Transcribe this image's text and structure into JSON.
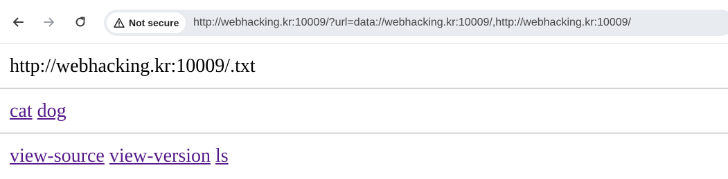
{
  "browser": {
    "security_label": "Not secure",
    "url": "http://webhacking.kr:10009/?url=data://webhacking.kr:10009/,http://webhacking.kr:10009/",
    "icons": {
      "back": "back-arrow-icon",
      "forward": "forward-arrow-icon",
      "reload": "reload-icon",
      "security": "warning-icon"
    }
  },
  "page": {
    "output_text": "http://webhacking.kr:10009/.txt",
    "animal_links": [
      "cat",
      "dog"
    ],
    "tool_links": [
      "view-source",
      "view-version",
      "ls"
    ]
  },
  "colors": {
    "visited_link": "#551a8b",
    "omnibox_bg": "#e8ebf0"
  }
}
